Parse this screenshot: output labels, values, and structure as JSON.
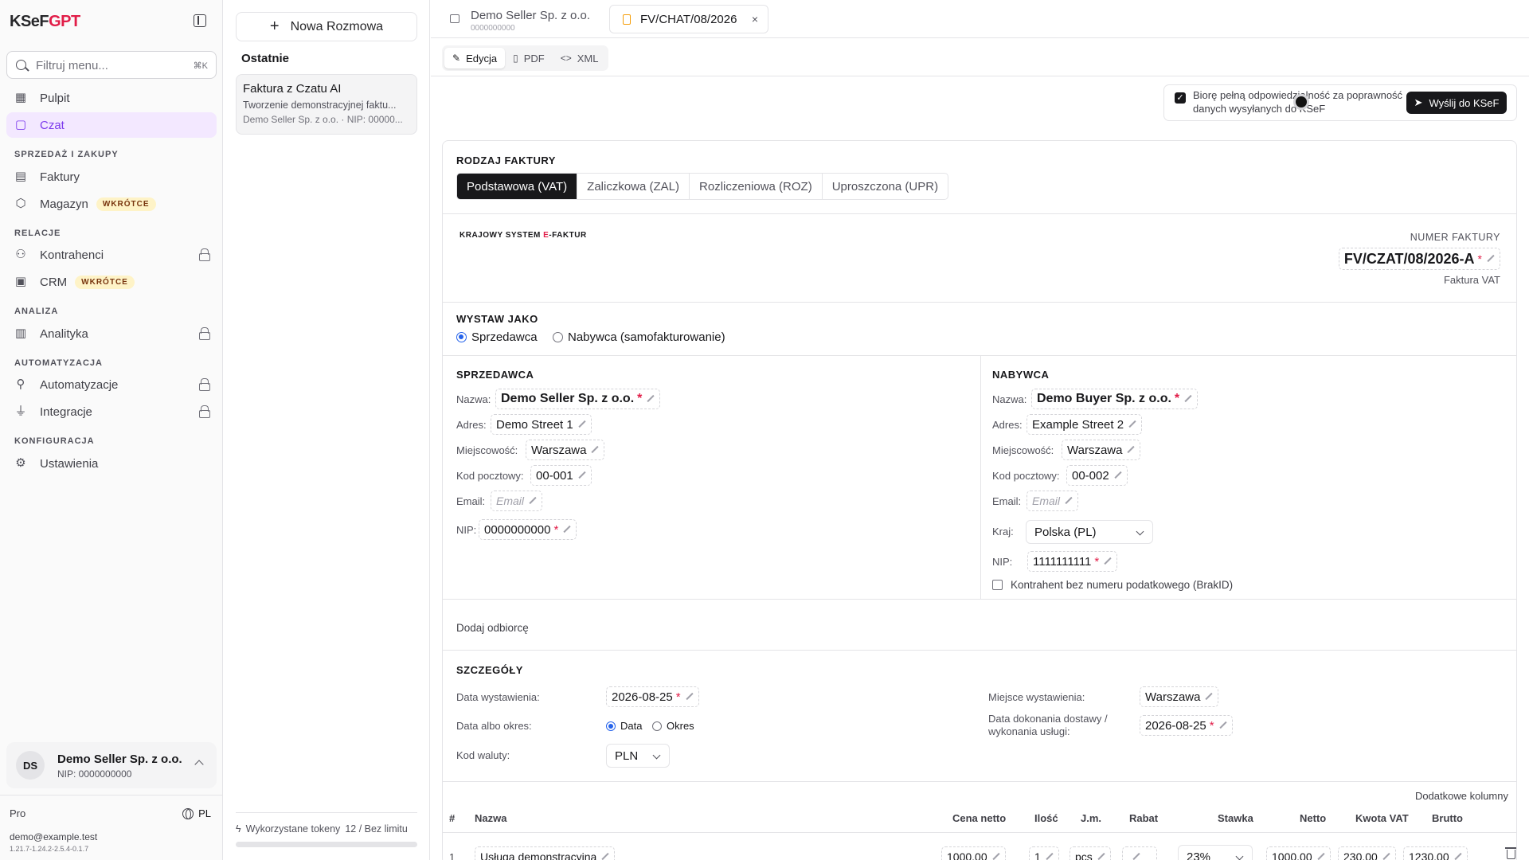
{
  "sidebar": {
    "logo_ksef": "KSeF",
    "logo_gpt": "GPT",
    "filter_placeholder": "Filtruj menu...",
    "filter_shortcut": "⌘K",
    "items": [
      {
        "label": "Pulpit",
        "icon": "dashboard-icon"
      },
      {
        "label": "Czat",
        "icon": "chat-icon",
        "active": true
      }
    ],
    "sections": [
      {
        "title": "SPRZEDAŻ I ZAKUPY",
        "items": [
          {
            "label": "Faktury",
            "icon": "file-icon"
          },
          {
            "label": "Magazyn",
            "icon": "box-icon",
            "badge": "WKRÓTCE"
          }
        ]
      },
      {
        "title": "RELACJE",
        "items": [
          {
            "label": "Kontrahenci",
            "icon": "users-icon",
            "locked": true
          },
          {
            "label": "CRM",
            "icon": "contact-icon",
            "badge": "WKRÓTCE"
          }
        ]
      },
      {
        "title": "ANALIZA",
        "items": [
          {
            "label": "Analityka",
            "icon": "chart-icon",
            "locked": true
          }
        ]
      },
      {
        "title": "AUTOMATYZACJA",
        "items": [
          {
            "label": "Automatyzacje",
            "icon": "workflow-icon",
            "locked": true
          },
          {
            "label": "Integracje",
            "icon": "plug-icon",
            "locked": true
          }
        ]
      },
      {
        "title": "KONFIGURACJA",
        "items": [
          {
            "label": "Ustawienia",
            "icon": "gear-icon"
          }
        ]
      }
    ],
    "user": {
      "initials": "DS",
      "name": "Demo Seller Sp. z o.o.",
      "nip": "NIP: 0000000000"
    },
    "plan": "Pro",
    "lang": "PL",
    "email": "demo@example.test",
    "version": "1.21.7-1.24.2-2.5.4-0.1.7"
  },
  "chatpanel": {
    "new_chat": "Nowa Rozmowa",
    "recent_title": "Ostatnie",
    "conversations": [
      {
        "title": "Faktura z Czatu AI",
        "subtitle": "Tworzenie demonstracyjnej faktu...",
        "meta": "Demo Seller Sp. z o.o. · NIP: 00000..."
      }
    ],
    "tokens_label": "Wykorzystane tokeny",
    "tokens_value": "12 / Bez limitu"
  },
  "tabs": {
    "tab1_title": "Demo Seller Sp. z o.o.",
    "tab1_sub": "0000000000",
    "tab2_title": "FV/CHAT/08/2026",
    "close": "×"
  },
  "view_tabs": [
    "Edycja",
    "PDF",
    "XML"
  ],
  "confirm": {
    "text": "Biorę pełną odpowiedzialność za poprawność danych wysyłanych do KSeF",
    "send": "Wyślij do KSeF"
  },
  "invoice": {
    "type_label": "RODZAJ FAKTURY",
    "types": [
      "Podstawowa (VAT)",
      "Zaliczkowa (ZAL)",
      "Rozliczeniowa (ROZ)",
      "Uproszczona (UPR)"
    ],
    "ksef_a": "KRAJOWY SYSTEM ",
    "ksef_e": "E",
    "ksef_b": "-FAKTUR",
    "number_label": "NUMER FAKTURY",
    "number": "FV/CZAT/08/2026-A",
    "req": "*",
    "invoice_kind": "Faktura VAT",
    "issue_as_label": "WYSTAW JAKO",
    "issue_as": [
      "Sprzedawca",
      "Nabywca (samofakturowanie)"
    ],
    "seller": {
      "title": "SPRZEDAWCA",
      "l_name": "Nazwa:",
      "name": "Demo Seller Sp. z o.o.",
      "l_addr": "Adres:",
      "addr": "Demo Street 1",
      "l_city": "Miejscowość:",
      "city": "Warszawa",
      "l_zip": "Kod pocztowy:",
      "zip": "00-001",
      "l_email": "Email:",
      "email_ph": "Email",
      "l_nip": "NIP:",
      "nip": "0000000000"
    },
    "buyer": {
      "title": "NABYWCA",
      "l_name": "Nazwa:",
      "name": "Demo Buyer Sp. z o.o.",
      "l_addr": "Adres:",
      "addr": "Example Street 2",
      "l_city": "Miejscowość:",
      "city": "Warszawa",
      "l_zip": "Kod pocztowy:",
      "zip": "00-002",
      "l_email": "Email:",
      "email_ph": "Email",
      "l_country": "Kraj:",
      "country": "Polska (PL)",
      "l_nip": "NIP:",
      "nip": "1111111111",
      "brakid": "Kontrahent bez numeru podatkowego (BrakID)"
    },
    "add_recipient": "Dodaj odbiorcę",
    "details": {
      "title": "SZCZEGÓŁY",
      "l_issue_date": "Data wystawienia:",
      "issue_date": "2026-08-25",
      "l_date_or_period": "Data albo okres:",
      "opt_date": "Data",
      "opt_period": "Okres",
      "l_currency": "Kod waluty:",
      "currency": "PLN",
      "l_place": "Miejsce wystawienia:",
      "place": "Warszawa",
      "l_delivery": "Data dokonania dostawy / wykonania usługi:",
      "delivery": "2026-08-25"
    },
    "extra_cols": "Dodatkowe kolumny",
    "columns": [
      "#",
      "Nazwa",
      "Cena netto",
      "Ilość",
      "J.m.",
      "Rabat",
      "Stawka",
      "Netto",
      "Kwota VAT",
      "Brutto"
    ],
    "rows": [
      {
        "no": "1",
        "name": "Usługa demonstracyjna",
        "price": "1000.00",
        "qty": "1",
        "unit": "pcs",
        "discount": "",
        "rate": "23%",
        "net": "1000.00",
        "vat": "230.00",
        "gross": "1230.00"
      }
    ]
  }
}
